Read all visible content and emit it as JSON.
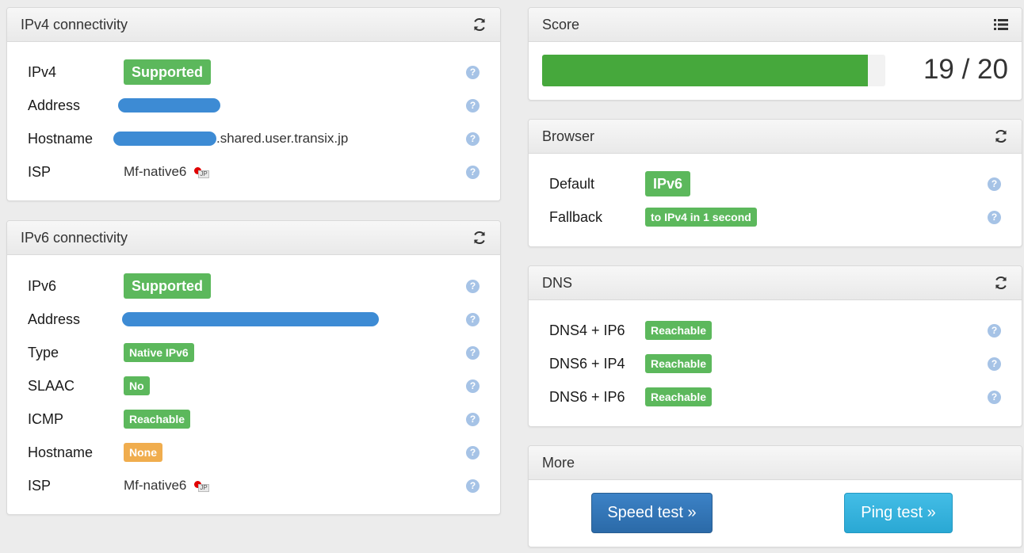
{
  "colors": {
    "green_badge": "#5cb85c",
    "orange_badge": "#f0ad4e",
    "progress_fill": "#46a83c",
    "redaction_blue": "#3d8bd4",
    "help_icon": "#a6c3e6"
  },
  "ipv4": {
    "title": "IPv4 connectivity",
    "rows": [
      {
        "label": "IPv4",
        "badge": "Supported"
      },
      {
        "label": "Address"
      },
      {
        "label": "Hostname",
        "suffix": ".shared.user.transix.jp"
      },
      {
        "label": "ISP",
        "value": "Mf-native6"
      }
    ]
  },
  "ipv6": {
    "title": "IPv6 connectivity",
    "rows": [
      {
        "label": "IPv6",
        "badge": "Supported"
      },
      {
        "label": "Address"
      },
      {
        "label": "Type",
        "badge": "Native IPv6"
      },
      {
        "label": "SLAAC",
        "badge": "No"
      },
      {
        "label": "ICMP",
        "badge": "Reachable"
      },
      {
        "label": "Hostname",
        "badge": "None"
      },
      {
        "label": "ISP",
        "value": "Mf-native6"
      }
    ]
  },
  "score": {
    "title": "Score",
    "value": 19,
    "max": 20,
    "text": "19 / 20"
  },
  "browser": {
    "title": "Browser",
    "rows": [
      {
        "label": "Default",
        "badge": "IPv6"
      },
      {
        "label": "Fallback",
        "badge": "to IPv4 in 1 second"
      }
    ]
  },
  "dns": {
    "title": "DNS",
    "rows": [
      {
        "label": "DNS4 + IP6",
        "badge": "Reachable"
      },
      {
        "label": "DNS6 + IP4",
        "badge": "Reachable"
      },
      {
        "label": "DNS6 + IP6",
        "badge": "Reachable"
      }
    ]
  },
  "more": {
    "title": "More",
    "speed_test": "Speed test »",
    "ping_test": "Ping test »"
  },
  "icons": {
    "refresh": "refresh-icon",
    "list": "list-icon",
    "help": "help-icon",
    "flag": "japan-flag-icon"
  }
}
